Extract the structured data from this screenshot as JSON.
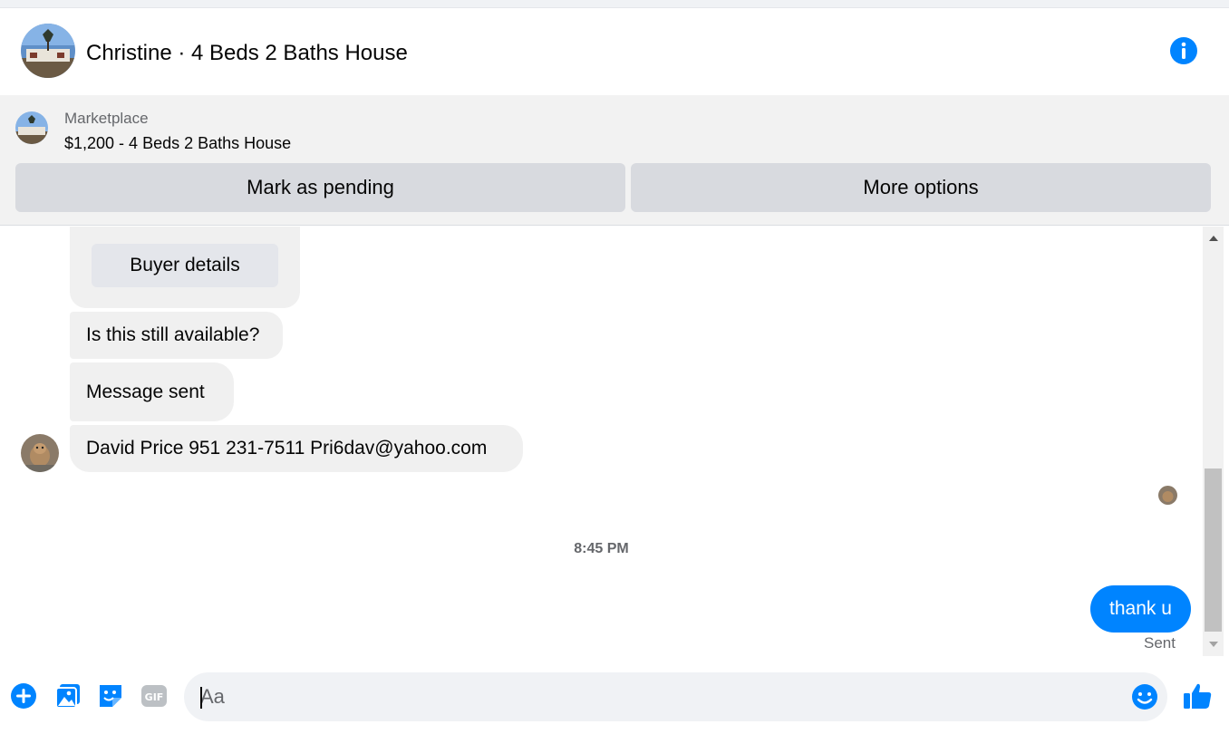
{
  "header": {
    "title": "Christine · 4 Beds 2 Baths House",
    "avatar_icon": "house-photo-avatar",
    "info_icon": "info-icon"
  },
  "banner": {
    "source": "Marketplace",
    "listing": "$1,200 - 4 Beds 2 Baths House",
    "mark_pending_label": "Mark as pending",
    "more_options_label": "More options"
  },
  "thread": {
    "buyer_details_label": "Buyer details",
    "messages": [
      {
        "text": "Is this still available?"
      },
      {
        "text": "Message sent"
      },
      {
        "text": "David Price 951 231-7511 Pri6dav@yahoo.com"
      }
    ],
    "timestamp": "8:45 PM",
    "my_message": "thank u",
    "status": "Sent"
  },
  "composer": {
    "placeholder": "Aa",
    "icons": [
      "add-icon",
      "photo-icon",
      "sticker-icon",
      "gif-icon",
      "emoji-icon",
      "thumbs-up-icon"
    ]
  },
  "colors": {
    "accent": "#0084ff",
    "bubble_gray": "#f0f0f0",
    "button_gray": "#d8dadf",
    "banner_bg": "#f2f2f2",
    "muted_text": "#65676b"
  }
}
